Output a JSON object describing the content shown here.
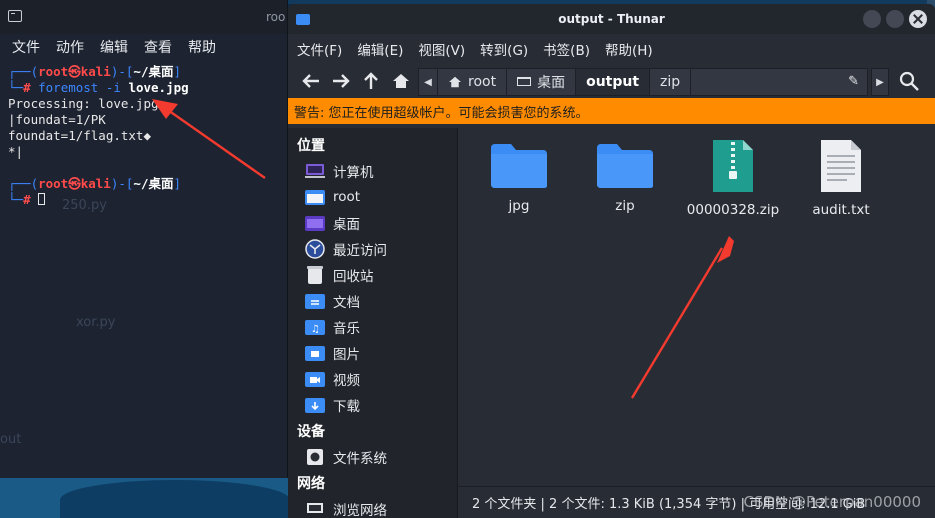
{
  "terminal": {
    "title_fragment": "roo",
    "menu": [
      "文件",
      "动作",
      "编辑",
      "查看",
      "帮助"
    ],
    "prompt_user": "root",
    "prompt_at": "㉿",
    "prompt_host": "kali",
    "prompt_dir": "~/桌面",
    "command": "foremost -i",
    "command_arg": "love.jpg",
    "output": [
      "Processing: love.jpg",
      "|foundat=1/PK",
      "foundat=1/flag.txt◆",
      "*|"
    ],
    "ghost_texts": [
      "250.py",
      "xor.py",
      "out"
    ]
  },
  "thunar": {
    "title": "output - Thunar",
    "menu": [
      "文件(F)",
      "编辑(E)",
      "视图(V)",
      "转到(G)",
      "书签(B)",
      "帮助(H)"
    ],
    "path": [
      "root",
      "桌面",
      "output",
      "zip"
    ],
    "warning": "警告: 您正在使用超级帐户。可能会损害您的系统。",
    "sidebar": {
      "places_header": "位置",
      "places": [
        "计算机",
        "root",
        "桌面",
        "最近访问",
        "回收站",
        "文档",
        "音乐",
        "图片",
        "视频",
        "下载"
      ],
      "devices_header": "设备",
      "devices": [
        "文件系统"
      ],
      "network_header": "网络",
      "network": [
        "浏览网络"
      ]
    },
    "files": [
      {
        "name": "jpg",
        "icon": "folder-icon"
      },
      {
        "name": "zip",
        "icon": "folder-icon"
      },
      {
        "name": "00000328.zip",
        "icon": "zip-archive-icon"
      },
      {
        "name": "audit.txt",
        "icon": "text-file-icon"
      }
    ],
    "status": "2 个文件夹 | 2 个文件: 1.3 KiB (1,354 字节) | 可用空间: 12.1 GiB",
    "watermark": "CSDN @Peterpan00000"
  },
  "colors": {
    "accent_folder": "#3b8cf5",
    "warning_bar": "#ff8c00",
    "annotation_arrow": "#f23a2f"
  }
}
